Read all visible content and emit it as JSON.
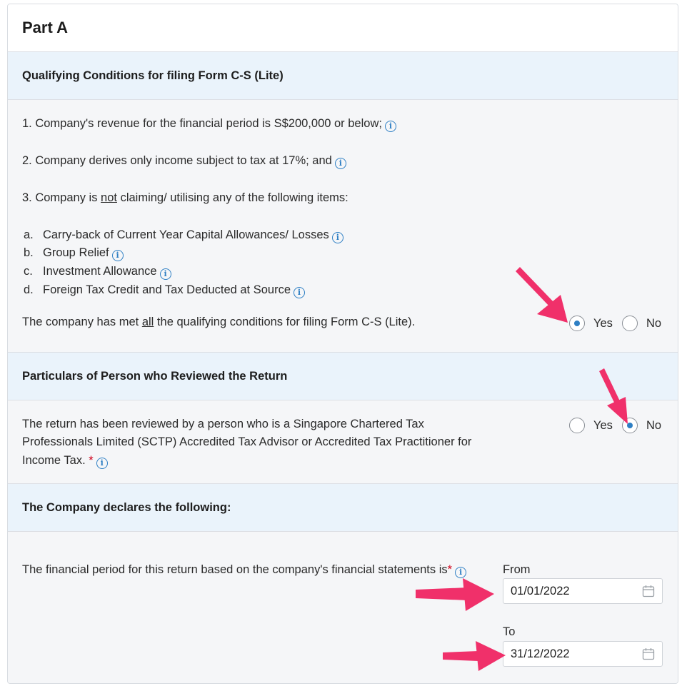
{
  "part_title": "Part A",
  "qualifying": {
    "header": "Qualifying Conditions for filing Form C-S (Lite)",
    "item1": "1. Company's revenue for the financial period is S$200,000 or below;",
    "item2": "2. Company derives only income subject to tax at 17%; and",
    "item3_pre": "3. Company is ",
    "item3_not": "not",
    "item3_post": " claiming/ utilising any of the following items:",
    "sub_items": [
      {
        "letter": "a.",
        "text": "Carry-back of Current Year Capital Allowances/ Losses"
      },
      {
        "letter": "b.",
        "text": "Group Relief"
      },
      {
        "letter": "c.",
        "text": "Investment Allowance"
      },
      {
        "letter": "d.",
        "text": "Foreign Tax Credit and Tax Deducted at Source"
      }
    ],
    "met_pre": "The company has met ",
    "met_all": "all",
    "met_post": " the qualifying conditions for filing Form C-S (Lite).",
    "yes_label": "Yes",
    "no_label": "No",
    "selected": "Yes"
  },
  "reviewer": {
    "header": "Particulars of Person who Reviewed the Return",
    "line1": "The return has been reviewed by a person who is a Singapore Chartered Tax",
    "line2": "Professionals Limited (SCTP) Accredited Tax Advisor or Accredited Tax Practitioner for",
    "line3": "Income Tax.",
    "required_mark": "*",
    "yes_label": "Yes",
    "no_label": "No",
    "selected": "No"
  },
  "declaration": {
    "header": "The Company declares the following:",
    "period_text": "The financial period for this return based on the company's financial statements is",
    "required_mark": "*",
    "from_label": "From",
    "from_value": "01/01/2022",
    "to_label": "To",
    "to_value": "31/12/2022"
  },
  "icons": {
    "info": "info-icon",
    "calendar": "calendar-icon",
    "annotation_arrow": "arrow-annotation"
  },
  "colors": {
    "accent": "#2e7fc4",
    "section_header_bg": "#eaf3fb",
    "body_bg": "#f5f6f8",
    "annotation_arrow": "#f0306a",
    "required": "#d0021b"
  }
}
